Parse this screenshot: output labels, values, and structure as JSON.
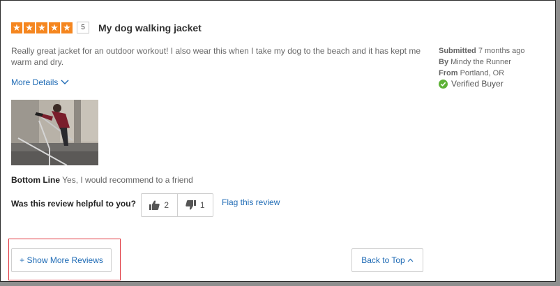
{
  "review": {
    "rating": 5,
    "rating_count_label": "5",
    "title": "My dog walking jacket",
    "body": "Really great jacket for an outdoor workout! I also wear this when I take my dog to the beach and it has kept me warm and dry.",
    "more_details": "More Details",
    "submitted_label": "Submitted",
    "submitted_value": "7 months ago",
    "by_label": "By",
    "by_value": "Mindy the Runner",
    "from_label": "From",
    "from_value": "Portland, OR",
    "verified": "Verified Buyer",
    "bottom_line_label": "Bottom Line",
    "bottom_line_value": "Yes, I would recommend to a friend",
    "helpful_question": "Was this review helpful to you?",
    "helpful_yes": "2",
    "helpful_no": "1",
    "flag": "Flag this review"
  },
  "footer": {
    "show_more": "+ Show More Reviews",
    "back_to_top": "Back to Top"
  },
  "colors": {
    "star": "#f5861f",
    "link": "#1f6bb5",
    "verified": "#5cb135",
    "highlight": "#e0373f"
  }
}
